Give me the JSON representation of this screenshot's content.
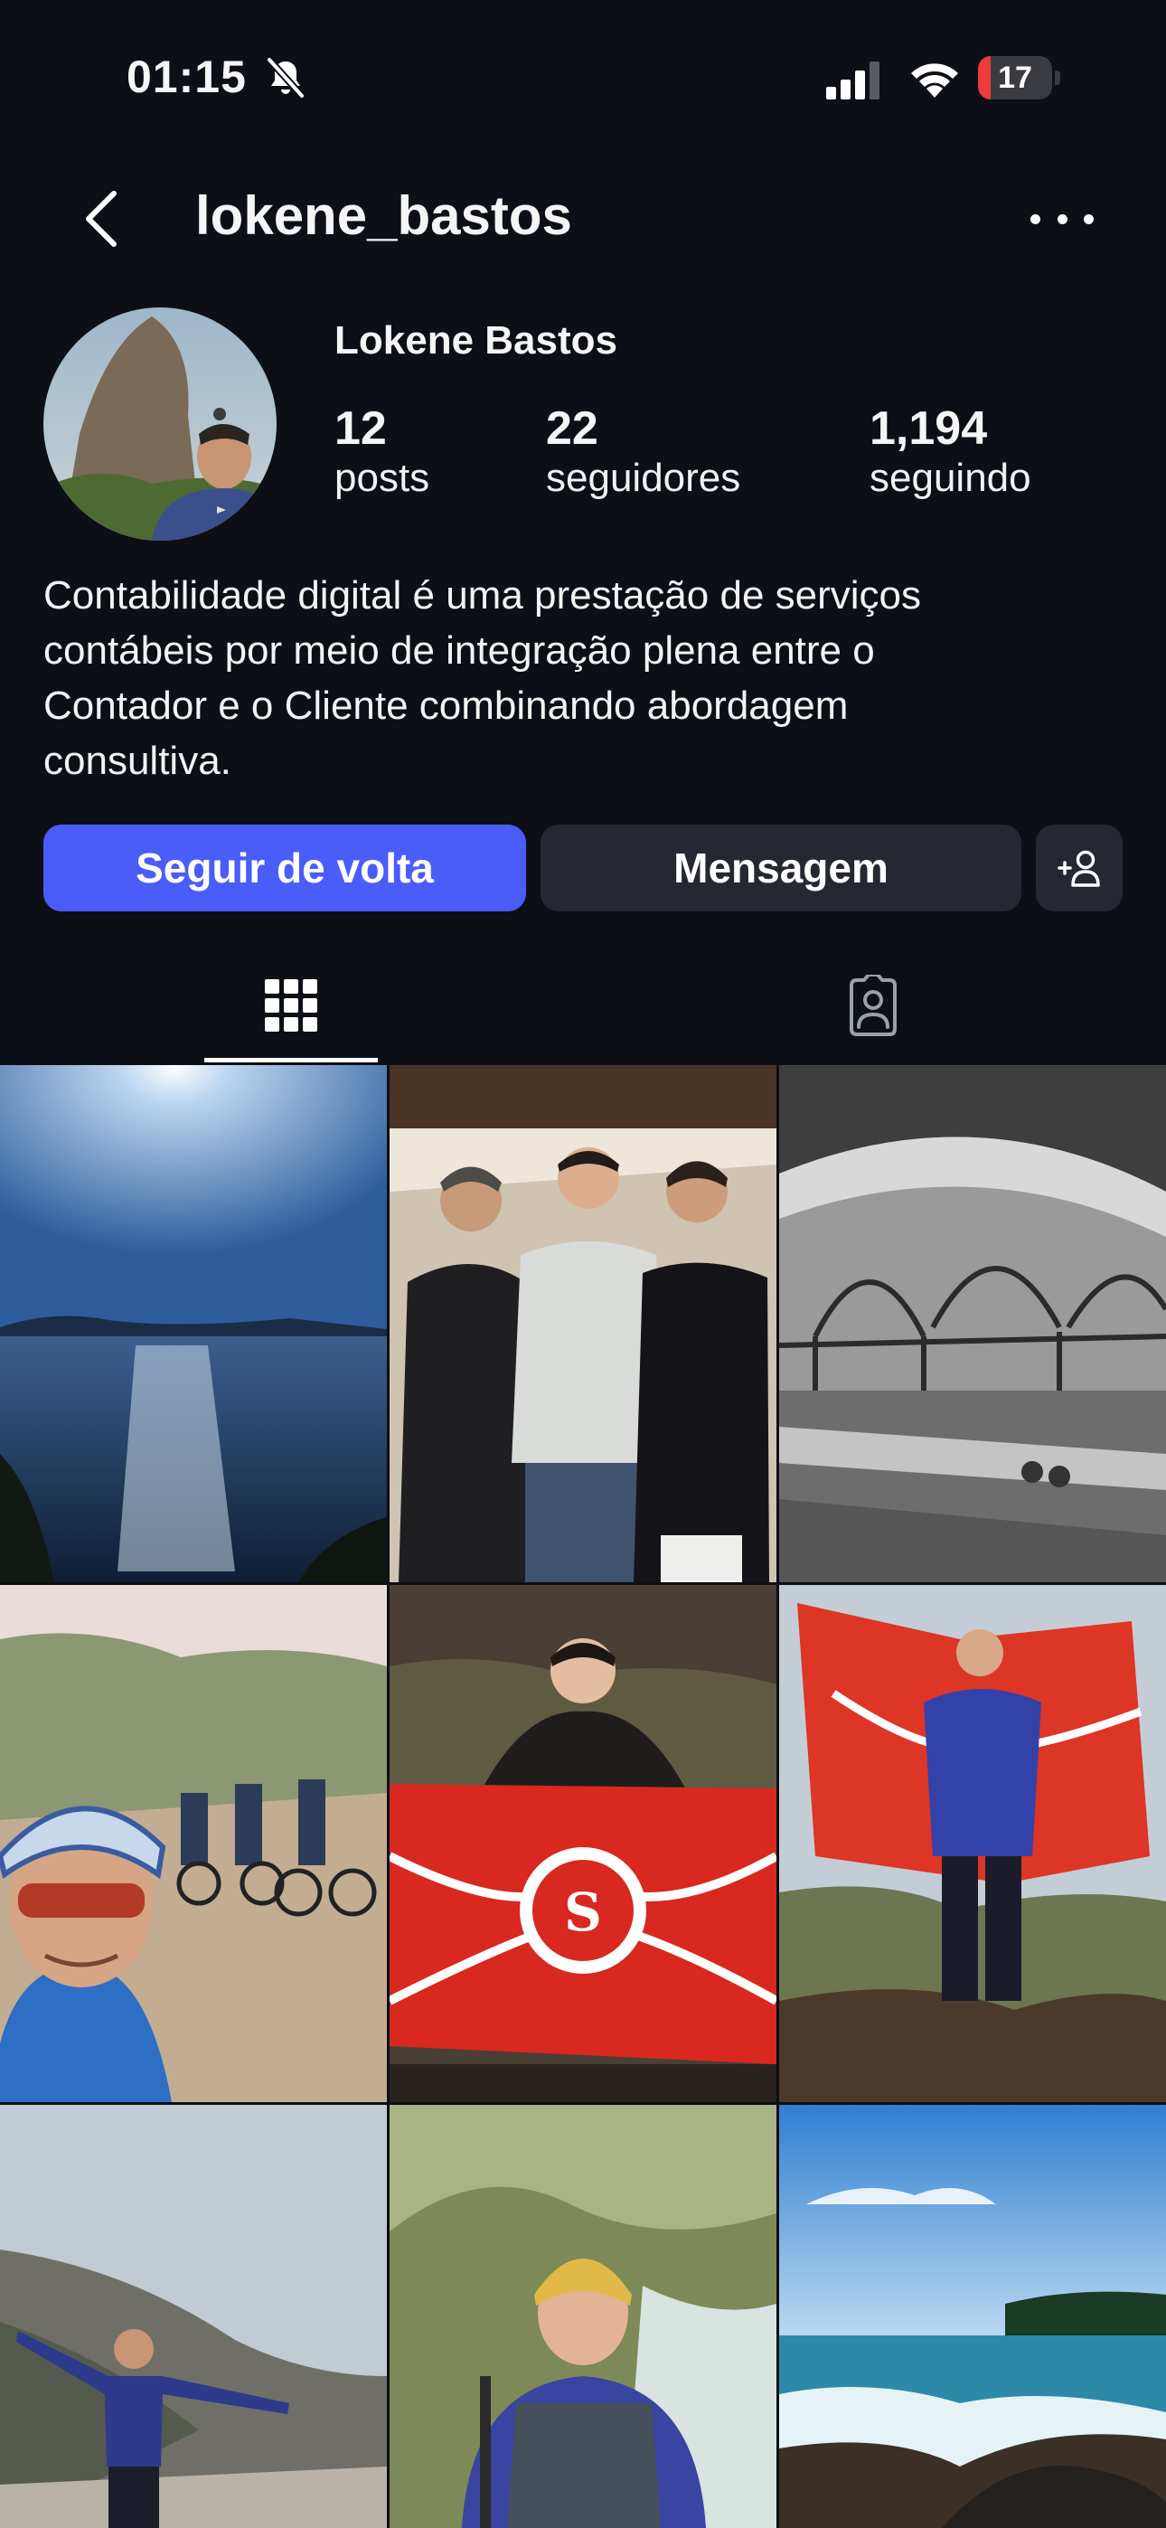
{
  "status_bar": {
    "time": "01:15",
    "battery": "17",
    "battery_level": 0.17,
    "icons": [
      "bell-slash-icon",
      "cellular-signal-icon",
      "wifi-icon",
      "battery-icon"
    ]
  },
  "header": {
    "username": "lokene_bastos",
    "back_icon": "chevron-left-icon",
    "more_icon": "ellipsis-icon"
  },
  "profile": {
    "display_name": "Lokene Bastos",
    "stats": [
      {
        "value": "12",
        "label": "posts"
      },
      {
        "value": "22",
        "label": "seguidores"
      },
      {
        "value": "1,194",
        "label": "seguindo"
      }
    ],
    "bio": "Contabilidade digital é uma prestação de serviços\ncontábeis por meio de integração plena entre o\nContador e o Cliente combinando abordagem\nconsultiva."
  },
  "actions": {
    "follow_back": "Seguir de volta",
    "message": "Mensagem",
    "add_person_icon": "person-add-icon"
  },
  "tabs": [
    {
      "icon": "grid-icon",
      "selected": true
    },
    {
      "icon": "tagged-person-icon",
      "selected": false
    }
  ],
  "colors": {
    "background": "#0c0f16",
    "accent": "#4a5df9",
    "button_secondary": "#252830",
    "battery_low": "#eb3b3b"
  },
  "posts": [
    {
      "subject": "ocean-sun-photo"
    },
    {
      "subject": "three-men-photo"
    },
    {
      "subject": "station-bw-photo"
    },
    {
      "subject": "cyclist-selfie-photo"
    },
    {
      "subject": "man-red-flag-photo"
    },
    {
      "subject": "woman-red-flag-photo"
    },
    {
      "subject": "man-cliff-arms-photo"
    },
    {
      "subject": "man-rafting-helmet-photo"
    },
    {
      "subject": "beach-rocks-photo"
    }
  ]
}
